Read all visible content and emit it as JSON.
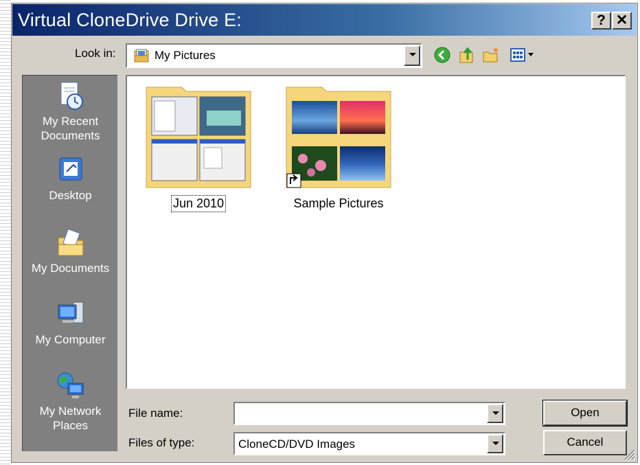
{
  "window": {
    "title": "Virtual CloneDrive Drive E:",
    "help_label": "?",
    "close_label": "✕"
  },
  "lookin": {
    "label": "Look in:",
    "value": "My Pictures",
    "icon": "my-pictures-icon"
  },
  "toolbar": {
    "icons": [
      "back-icon",
      "up-folder-icon",
      "new-folder-icon",
      "views-menu-icon"
    ]
  },
  "places": [
    {
      "label": "My Recent Documents",
      "icon": "recent-documents-icon"
    },
    {
      "label": "Desktop",
      "icon": "desktop-icon"
    },
    {
      "label": "My Documents",
      "icon": "my-documents-icon"
    },
    {
      "label": "My Computer",
      "icon": "my-computer-icon"
    },
    {
      "label": "My Network Places",
      "icon": "network-places-icon"
    }
  ],
  "files": [
    {
      "name": "Jun 2010",
      "type": "folder",
      "focused": true
    },
    {
      "name": "Sample Pictures",
      "type": "folder-shortcut",
      "focused": false
    }
  ],
  "filename": {
    "label": "File name:",
    "value": ""
  },
  "filetype": {
    "label": "Files of type:",
    "value": "CloneCD/DVD Images"
  },
  "buttons": {
    "open": "Open",
    "cancel": "Cancel"
  },
  "colors": {
    "title_start": "#0a246a",
    "title_end": "#a6caf0",
    "face": "#d4d0c8",
    "places_bg": "#808080",
    "folder": "#f5d67a"
  }
}
